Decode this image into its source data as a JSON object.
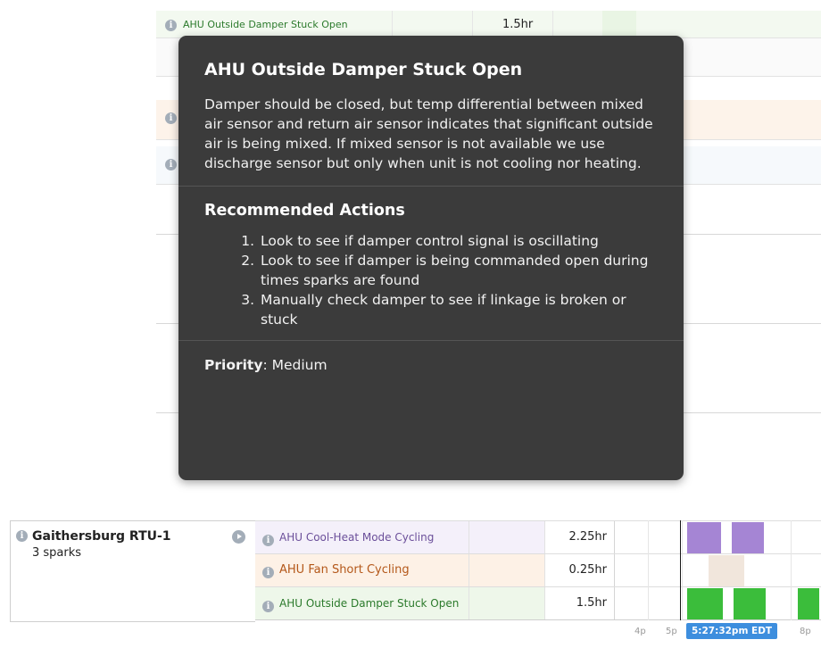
{
  "background_rows": {
    "first_label": "AHU Outside Damper Stuck Open",
    "first_duration": "1.5hr"
  },
  "tooltip": {
    "title": "AHU Outside Damper Stuck Open",
    "description": "Damper should be closed, but temp differential between mixed air sensor and return air sensor indicates that significant outside air is being mixed. If mixed sensor is not available we use discharge sensor but only when unit is not cooling nor heating.",
    "actions_heading": "Recommended Actions",
    "actions": [
      "Look to see if damper control signal is oscillating",
      "Look to see if damper is being commanded open during times sparks are found",
      "Manually check damper to see if linkage is broken or stuck"
    ],
    "priority_label": "Priority",
    "priority_value": ": Medium"
  },
  "asset": {
    "name": "Gaithersburg RTU-1",
    "sparks": "3 sparks"
  },
  "sparks": [
    {
      "name": "AHU Cool-Heat Mode Cycling",
      "duration": "2.25hr",
      "color": "#6b4f9a",
      "bg": "#f4f0fa",
      "block_color": "#a585d4"
    },
    {
      "name": "AHU Fan Short Cycling",
      "duration": "0.25hr",
      "color": "#b4581a",
      "bg": "#fdf1e6",
      "block_color": "#f1e6dc"
    },
    {
      "name": "AHU Outside Damper Stuck Open",
      "duration": "1.5hr",
      "color": "#2b7a2b",
      "bg": "#eef7ea",
      "block_color": "#3bbd3b"
    }
  ],
  "timeline": {
    "ticks": [
      "4p",
      "5p",
      "8p"
    ],
    "current_time": "5:27:32pm EDT"
  },
  "colors": {
    "tooltip_bg": "#3b3b3b",
    "now_badge": "#3d8ede"
  }
}
